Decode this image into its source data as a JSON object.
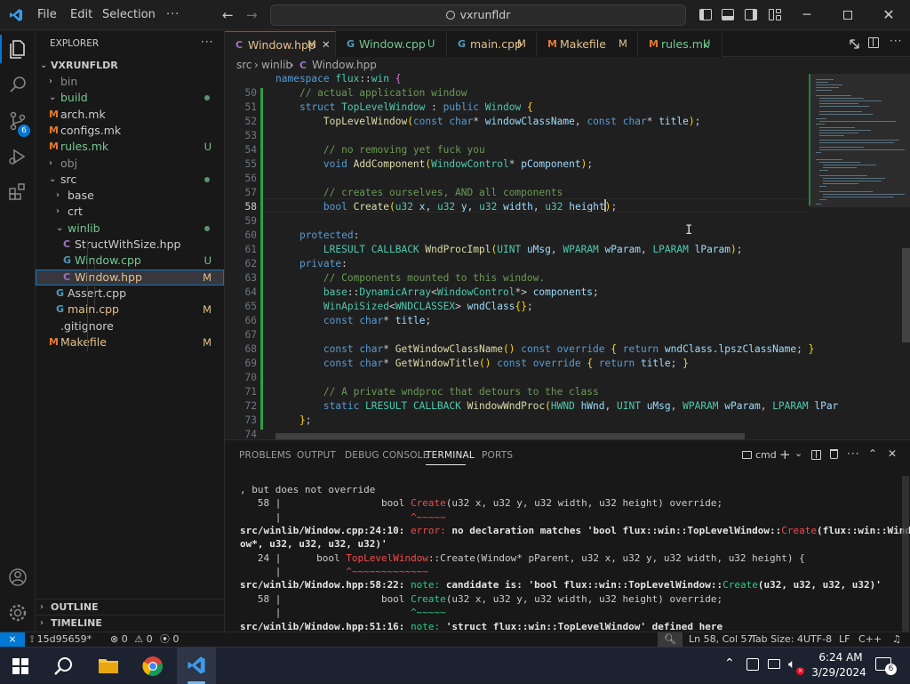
{
  "app": {
    "menu": [
      "File",
      "Edit",
      "Selection"
    ],
    "more": "···",
    "search": "vxrunfldr",
    "colors": {
      "accent": "#0078d4",
      "modified": "#e2c08d",
      "untracked": "#73c991",
      "error": "#f14c4c"
    }
  },
  "sidebar": {
    "title": "EXPLORER",
    "more": "···",
    "root": "VXRUNFLDR",
    "items": [
      {
        "name": "bin",
        "type": "folder",
        "open": false,
        "depth": 1,
        "status": "",
        "dot": false,
        "color": "#8c8c8c"
      },
      {
        "name": "build",
        "type": "folder",
        "open": true,
        "depth": 1,
        "status": "",
        "dot": true,
        "color": "#73c991"
      },
      {
        "name": "arch.mk",
        "type": "file",
        "depth": 1,
        "status": "",
        "dot": false,
        "color": "#cccccc"
      },
      {
        "name": "configs.mk",
        "type": "file",
        "depth": 1,
        "status": "",
        "dot": false,
        "color": "#cccccc"
      },
      {
        "name": "rules.mk",
        "type": "file",
        "depth": 1,
        "status": "U",
        "dot": false,
        "color": "#73c991"
      },
      {
        "name": "obj",
        "type": "folder",
        "open": false,
        "depth": 1,
        "status": "",
        "dot": false,
        "color": "#8c8c8c"
      },
      {
        "name": "src",
        "type": "folder",
        "open": true,
        "depth": 1,
        "status": "",
        "dot": true,
        "color": "#cccccc"
      },
      {
        "name": "base",
        "type": "folder",
        "open": false,
        "depth": 2,
        "status": "",
        "dot": false,
        "color": "#cccccc"
      },
      {
        "name": "crt",
        "type": "folder",
        "open": false,
        "depth": 2,
        "status": "",
        "dot": false,
        "color": "#cccccc"
      },
      {
        "name": "winlib",
        "type": "folder",
        "open": true,
        "depth": 2,
        "status": "",
        "dot": true,
        "color": "#73c991"
      },
      {
        "name": "StructWithSize.hpp",
        "type": "file",
        "depth": 3,
        "status": "",
        "dot": false,
        "color": "#cccccc"
      },
      {
        "name": "Window.cpp",
        "type": "file",
        "depth": 3,
        "status": "U",
        "dot": false,
        "color": "#73c991"
      },
      {
        "name": "Window.hpp",
        "type": "file",
        "depth": 3,
        "status": "M",
        "dot": false,
        "color": "#e2c08d",
        "selected": true
      },
      {
        "name": "Assert.cpp",
        "type": "file",
        "depth": 2,
        "status": "",
        "dot": false,
        "color": "#cccccc"
      },
      {
        "name": "main.cpp",
        "type": "file",
        "depth": 2,
        "status": "M",
        "dot": false,
        "color": "#e2c08d"
      },
      {
        "name": ".gitignore",
        "type": "file",
        "depth": 1,
        "status": "",
        "dot": false,
        "color": "#cccccc"
      },
      {
        "name": "Makefile",
        "type": "file",
        "depth": 1,
        "status": "M",
        "dot": false,
        "color": "#e2c08d"
      }
    ],
    "outline": "OUTLINE",
    "timeline": "TIMELINE"
  },
  "tabs": [
    {
      "label": "Window.hpp",
      "status": "M",
      "active": true,
      "icon": "C",
      "color": "#e2c08d",
      "icon_color": "#a074c4"
    },
    {
      "label": "Window.cpp",
      "status": "U",
      "active": false,
      "icon": "G",
      "color": "#73c991",
      "icon_color": "#519aba"
    },
    {
      "label": "main.cpp",
      "status": "M",
      "active": false,
      "icon": "G",
      "color": "#e2c08d",
      "icon_color": "#519aba"
    },
    {
      "label": "Makefile",
      "status": "M",
      "active": false,
      "icon": "M",
      "color": "#e2c08d",
      "icon_color": "#e37933"
    },
    {
      "label": "rules.mk",
      "status": "U",
      "active": false,
      "icon": "M",
      "color": "#73c991",
      "icon_color": "#e37933"
    }
  ],
  "breadcrumb": [
    "src",
    "winlib",
    "Window.hpp"
  ],
  "editor": {
    "lines": [
      {
        "n": "",
        "t": [
          [
            "kw",
            "namespace "
          ],
          [
            "ty",
            "flux"
          ],
          [
            "",
            "::"
          ],
          [
            "ty",
            "win"
          ],
          [
            "br",
            " {"
          ]
        ]
      },
      {
        "n": "50",
        "t": [
          [
            "",
            "    "
          ],
          [
            "cm",
            "// actual application window"
          ]
        ]
      },
      {
        "n": "51",
        "t": [
          [
            "",
            "    "
          ],
          [
            "kw",
            "struct "
          ],
          [
            "ty",
            "TopLevelWindow"
          ],
          [
            "",
            " : "
          ],
          [
            "kw",
            "public "
          ],
          [
            "ty",
            "Window"
          ],
          [
            "br2",
            " {"
          ]
        ]
      },
      {
        "n": "52",
        "t": [
          [
            "",
            "        "
          ],
          [
            "fn",
            "TopLevelWindow"
          ],
          [
            "br2",
            "("
          ],
          [
            "kw",
            "const "
          ],
          [
            "kw",
            "char"
          ],
          [
            "",
            "* "
          ],
          [
            "pm",
            "windowClassName"
          ],
          [
            ", "
          ],
          [
            "kw",
            "const "
          ],
          [
            "kw",
            "char"
          ],
          [
            "",
            "* "
          ],
          [
            "pm",
            "title"
          ],
          [
            "br2",
            ")"
          ],
          [
            "",
            ";"
          ]
        ]
      },
      {
        "n": "53",
        "t": []
      },
      {
        "n": "54",
        "t": [
          [
            "",
            "        "
          ],
          [
            "cm",
            "// no removing yet fuck you"
          ]
        ]
      },
      {
        "n": "55",
        "t": [
          [
            "",
            "        "
          ],
          [
            "kw",
            "void "
          ],
          [
            "fn",
            "AddComponent"
          ],
          [
            "br2",
            "("
          ],
          [
            "ty",
            "WindowControl"
          ],
          [
            "",
            "* "
          ],
          [
            "pm",
            "pComponent"
          ],
          [
            "br2",
            ")"
          ],
          [
            "",
            ";"
          ]
        ]
      },
      {
        "n": "56",
        "t": []
      },
      {
        "n": "57",
        "t": [
          [
            "",
            "        "
          ],
          [
            "cm",
            "// creates ourselves, AND all components"
          ]
        ]
      },
      {
        "n": "58",
        "t": [
          [
            "",
            "        "
          ],
          [
            "kw",
            "bool "
          ],
          [
            "fn",
            "Create"
          ],
          [
            "br2",
            "("
          ],
          [
            "ty",
            "u32"
          ],
          [
            "",
            " "
          ],
          [
            "pm",
            "x"
          ],
          [
            "",
            ", "
          ],
          [
            "ty",
            "u32"
          ],
          [
            "",
            " "
          ],
          [
            "pm",
            "y"
          ],
          [
            "",
            ", "
          ],
          [
            "ty",
            "u32"
          ],
          [
            "",
            " "
          ],
          [
            "pm",
            "width"
          ],
          [
            "",
            ", "
          ],
          [
            "ty",
            "u32"
          ],
          [
            "",
            " "
          ],
          [
            "pm",
            "height"
          ],
          [
            "br2",
            ")"
          ],
          [
            "",
            ";"
          ]
        ]
      },
      {
        "n": "59",
        "t": []
      },
      {
        "n": "60",
        "t": [
          [
            "",
            "    "
          ],
          [
            "kw",
            "protected"
          ],
          [
            "",
            ":"
          ]
        ]
      },
      {
        "n": "61",
        "t": [
          [
            "",
            "        "
          ],
          [
            "ty",
            "LRESULT "
          ],
          [
            "ty",
            "CALLBACK "
          ],
          [
            "fn",
            "WndProcImpl"
          ],
          [
            "br2",
            "("
          ],
          [
            "ty",
            "UINT "
          ],
          [
            "pm",
            "uMsg"
          ],
          [
            "",
            ", "
          ],
          [
            "ty",
            "WPARAM "
          ],
          [
            "pm",
            "wParam"
          ],
          [
            "",
            ", "
          ],
          [
            "ty",
            "LPARAM "
          ],
          [
            "pm",
            "lParam"
          ],
          [
            "br2",
            ")"
          ],
          [
            "",
            ";"
          ]
        ]
      },
      {
        "n": "62",
        "t": [
          [
            "",
            "    "
          ],
          [
            "kw",
            "private"
          ],
          [
            "",
            ":"
          ]
        ]
      },
      {
        "n": "63",
        "t": [
          [
            "",
            "        "
          ],
          [
            "cm",
            "// Components mounted to this window."
          ]
        ]
      },
      {
        "n": "64",
        "t": [
          [
            "",
            "        "
          ],
          [
            "ty",
            "base"
          ],
          [
            "",
            "::"
          ],
          [
            "ty",
            "DynamicArray"
          ],
          [
            "",
            "<"
          ],
          [
            "ty",
            "WindowControl"
          ],
          [
            "",
            "*> "
          ],
          [
            "vr",
            "components"
          ],
          [
            "",
            ";"
          ]
        ]
      },
      {
        "n": "65",
        "t": [
          [
            "",
            "        "
          ],
          [
            "ty",
            "WinApiSized"
          ],
          [
            "",
            "<"
          ],
          [
            "ty",
            "WNDCLASSEX"
          ],
          [
            "",
            "> "
          ],
          [
            "vr",
            "wndClass"
          ],
          [
            "br2",
            "{}"
          ],
          [
            "",
            ";"
          ]
        ]
      },
      {
        "n": "66",
        "t": [
          [
            "",
            "        "
          ],
          [
            "kw",
            "const "
          ],
          [
            "kw",
            "char"
          ],
          [
            "",
            "* "
          ],
          [
            "vr",
            "title"
          ],
          [
            "",
            ";"
          ]
        ]
      },
      {
        "n": "67",
        "t": []
      },
      {
        "n": "68",
        "t": [
          [
            "",
            "        "
          ],
          [
            "kw",
            "const "
          ],
          [
            "kw",
            "char"
          ],
          [
            "",
            "* "
          ],
          [
            "fn",
            "GetWindowClassName"
          ],
          [
            "br2",
            "()"
          ],
          [
            "kw",
            " const "
          ],
          [
            "kw",
            "override "
          ],
          [
            "br2",
            "{ "
          ],
          [
            "kw",
            "return "
          ],
          [
            "vr",
            "wndClass"
          ],
          [
            "",
            "."
          ],
          [
            "vr",
            "lpszClassName"
          ],
          [
            "",
            "; "
          ],
          [
            "br2",
            "}"
          ]
        ]
      },
      {
        "n": "69",
        "t": [
          [
            "",
            "        "
          ],
          [
            "kw",
            "const "
          ],
          [
            "kw",
            "char"
          ],
          [
            "",
            "* "
          ],
          [
            "fn",
            "GetWindowTitle"
          ],
          [
            "br2",
            "()"
          ],
          [
            "kw",
            " const "
          ],
          [
            "kw",
            "override "
          ],
          [
            "br2",
            "{ "
          ],
          [
            "kw",
            "return "
          ],
          [
            "vr",
            "title"
          ],
          [
            "",
            "; "
          ],
          [
            "br2",
            "}"
          ]
        ]
      },
      {
        "n": "70",
        "t": []
      },
      {
        "n": "71",
        "t": [
          [
            "",
            "        "
          ],
          [
            "cm",
            "// A private wndproc that detours to the class"
          ]
        ]
      },
      {
        "n": "72",
        "t": [
          [
            "",
            "        "
          ],
          [
            "kw",
            "static "
          ],
          [
            "ty",
            "LRESULT "
          ],
          [
            "ty",
            "CALLBACK "
          ],
          [
            "fn",
            "WindowWndProc"
          ],
          [
            "br2",
            "("
          ],
          [
            "ty",
            "HWND "
          ],
          [
            "pm",
            "hWnd"
          ],
          [
            "",
            ", "
          ],
          [
            "ty",
            "UINT "
          ],
          [
            "pm",
            "uMsg"
          ],
          [
            "",
            ", "
          ],
          [
            "ty",
            "WPARAM "
          ],
          [
            "pm",
            "wParam"
          ],
          [
            "",
            ", "
          ],
          [
            "ty",
            "LPARAM "
          ],
          [
            "pm",
            "lPar"
          ]
        ]
      },
      {
        "n": "73",
        "t": [
          [
            "",
            "    "
          ],
          [
            "br2",
            "}"
          ],
          [
            "",
            ";"
          ]
        ]
      },
      {
        "n": "74",
        "t": []
      }
    ]
  },
  "panel": {
    "tabs": [
      "PROBLEMS",
      "OUTPUT",
      "DEBUG CONSOLE",
      "TERMINAL",
      "PORTS"
    ],
    "active": "TERMINAL",
    "shell": "cmd",
    "lines": [
      [
        [
          "",
          ", but does not override"
        ]
      ],
      [
        [
          "",
          "   58 |                 bool "
        ],
        [
          "err",
          "Create"
        ],
        [
          "",
          "(u32 x, u32 y, u32 width, u32 height) override;"
        ]
      ],
      [
        [
          "",
          "      |                      "
        ],
        [
          "err",
          "^~~~~~"
        ]
      ],
      [
        [
          "pth",
          "src/winlib/Window.cpp:24:10: "
        ],
        [
          "err",
          "error: "
        ],
        [
          "pth",
          "no declaration matches 'bool flux::win::TopLevelWindow::"
        ],
        [
          "err",
          "Create"
        ],
        [
          "pth",
          "(flux::win::Wind"
        ]
      ],
      [
        [
          "pth",
          "ow*, u32, u32, u32, u32)'"
        ]
      ],
      [
        [
          "",
          "   24 |      bool "
        ],
        [
          "err",
          "TopLevelWindow"
        ],
        [
          "",
          "::Create(Window* pParent, u32 x, u32 y, u32 width, u32 height) {"
        ]
      ],
      [
        [
          "",
          "      |           "
        ],
        [
          "err",
          "^~~~~~~~~~~~~~"
        ]
      ],
      [
        [
          "pth",
          "src/winlib/Window.hpp:58:22: "
        ],
        [
          "note",
          "note: "
        ],
        [
          "pth",
          "candidate is: 'bool flux::win::TopLevelWindow::"
        ],
        [
          "note",
          "Create"
        ],
        [
          "pth",
          "(u32, u32, u32, u32)'"
        ]
      ],
      [
        [
          "",
          "   58 |                 bool "
        ],
        [
          "note",
          "Create"
        ],
        [
          "",
          "(u32 x, u32 y, u32 width, u32 height) override;"
        ]
      ],
      [
        [
          "",
          "      |                      "
        ],
        [
          "note",
          "^~~~~~"
        ]
      ],
      [
        [
          "pth",
          "src/winlib/Window.hpp:51:16: "
        ],
        [
          "note",
          "note: "
        ],
        [
          "pth",
          "'struct flux::win::TopLevelWindow' defined here"
        ]
      ]
    ]
  },
  "status": {
    "branch": "15d95659*",
    "errors": "0",
    "warnings": "0",
    "ports": "0",
    "position": "Ln 58, Col 57",
    "tabsize": "Tab Size: 4",
    "encoding": "UTF-8",
    "eol": "LF",
    "language": "C++"
  },
  "taskbar": {
    "time": "6:24 AM",
    "date": "3/29/2024",
    "notifications": "6"
  }
}
